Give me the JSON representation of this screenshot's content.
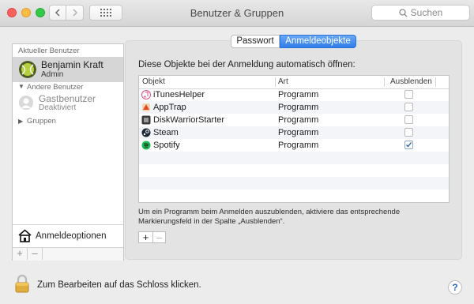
{
  "window": {
    "title": "Benutzer & Gruppen",
    "search_placeholder": "Suchen"
  },
  "sidebar": {
    "current_user_label": "Aktueller Benutzer",
    "current_user": {
      "name": "Benjamin Kraft",
      "role": "Admin"
    },
    "other_users_label": "Andere Benutzer",
    "guest": {
      "name": "Gastbenutzer",
      "status": "Deaktiviert"
    },
    "groups_label": "Gruppen",
    "login_options_label": "Anmeldeoptionen",
    "add": "+",
    "remove": "–"
  },
  "tabs": {
    "password": "Passwort",
    "login_items": "Anmeldeobjekte",
    "active": "login_items"
  },
  "main": {
    "intro": "Diese Objekte bei der Anmeldung automatisch öffnen:",
    "columns": {
      "item": "Objekt",
      "kind": "Art",
      "hide": "Ausblenden"
    },
    "items": [
      {
        "name": "iTunesHelper",
        "kind": "Programm",
        "hidden": false,
        "icon": "itunes-icon",
        "color": "#e24e8f"
      },
      {
        "name": "AppTrap",
        "kind": "Programm",
        "hidden": false,
        "icon": "apptrap-icon",
        "color": "#e6462b"
      },
      {
        "name": "DiskWarriorStarter",
        "kind": "Programm",
        "hidden": false,
        "icon": "diskwarrior-icon",
        "color": "#3b3b3b"
      },
      {
        "name": "Steam",
        "kind": "Programm",
        "hidden": false,
        "icon": "steam-icon",
        "color": "#1b2838"
      },
      {
        "name": "Spotify",
        "kind": "Programm",
        "hidden": true,
        "icon": "spotify-icon",
        "color": "#1db954"
      }
    ],
    "hint": "Um ein Programm beim Anmelden auszublenden, aktiviere das entsprechende Markierungsfeld in der Spalte „Ausblenden“.",
    "add": "+",
    "remove": "–"
  },
  "footer": {
    "lock_text": "Zum Bearbeiten auf das Schloss klicken.",
    "help": "?"
  }
}
